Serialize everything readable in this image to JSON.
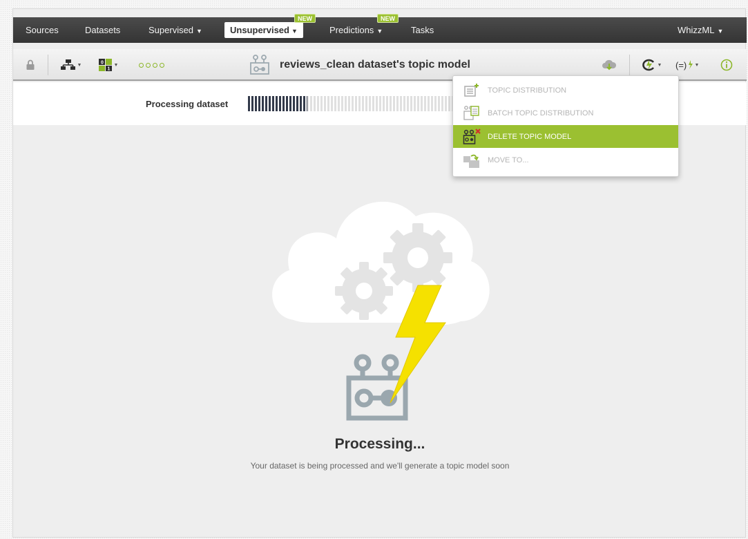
{
  "nav": {
    "items": [
      {
        "label": "Sources"
      },
      {
        "label": "Datasets"
      },
      {
        "label": "Supervised"
      },
      {
        "label": "Unsupervised"
      },
      {
        "label": "Predictions"
      },
      {
        "label": "Tasks"
      }
    ],
    "right_label": "WhizzML",
    "badges": {
      "unsupervised": "NEW",
      "predictions": "NEW"
    },
    "active_item": "Unsupervised"
  },
  "toolbar": {
    "title": "reviews_clean dataset's topic model",
    "icons": [
      "lock-icon",
      "tree-icon",
      "fields-icon",
      "dots-icon",
      "topic-model-icon",
      "cloud-download-icon",
      "actions-icon",
      "formula-icon",
      "info-icon"
    ]
  },
  "progress": {
    "label": "Processing dataset",
    "value": 0.2
  },
  "dropdown": {
    "items": [
      {
        "label": "TOPIC DISTRIBUTION",
        "icon": "topic-distribution-icon",
        "active": false
      },
      {
        "label": "BATCH TOPIC DISTRIBUTION",
        "icon": "batch-topic-distribution-icon",
        "active": false
      },
      {
        "label": "DELETE TOPIC MODEL",
        "icon": "delete-topic-model-icon",
        "active": true
      },
      {
        "label": "MOVE TO...",
        "icon": "move-to-icon",
        "active": false
      }
    ]
  },
  "main": {
    "title": "Processing...",
    "subtitle": "Your dataset is being processed and we'll generate a topic model soon"
  },
  "colors": {
    "accent": "#9bc031",
    "nav_bg": "#3f3f3f",
    "lightning": "#f5e100",
    "progress_fill": "#333a4a"
  }
}
